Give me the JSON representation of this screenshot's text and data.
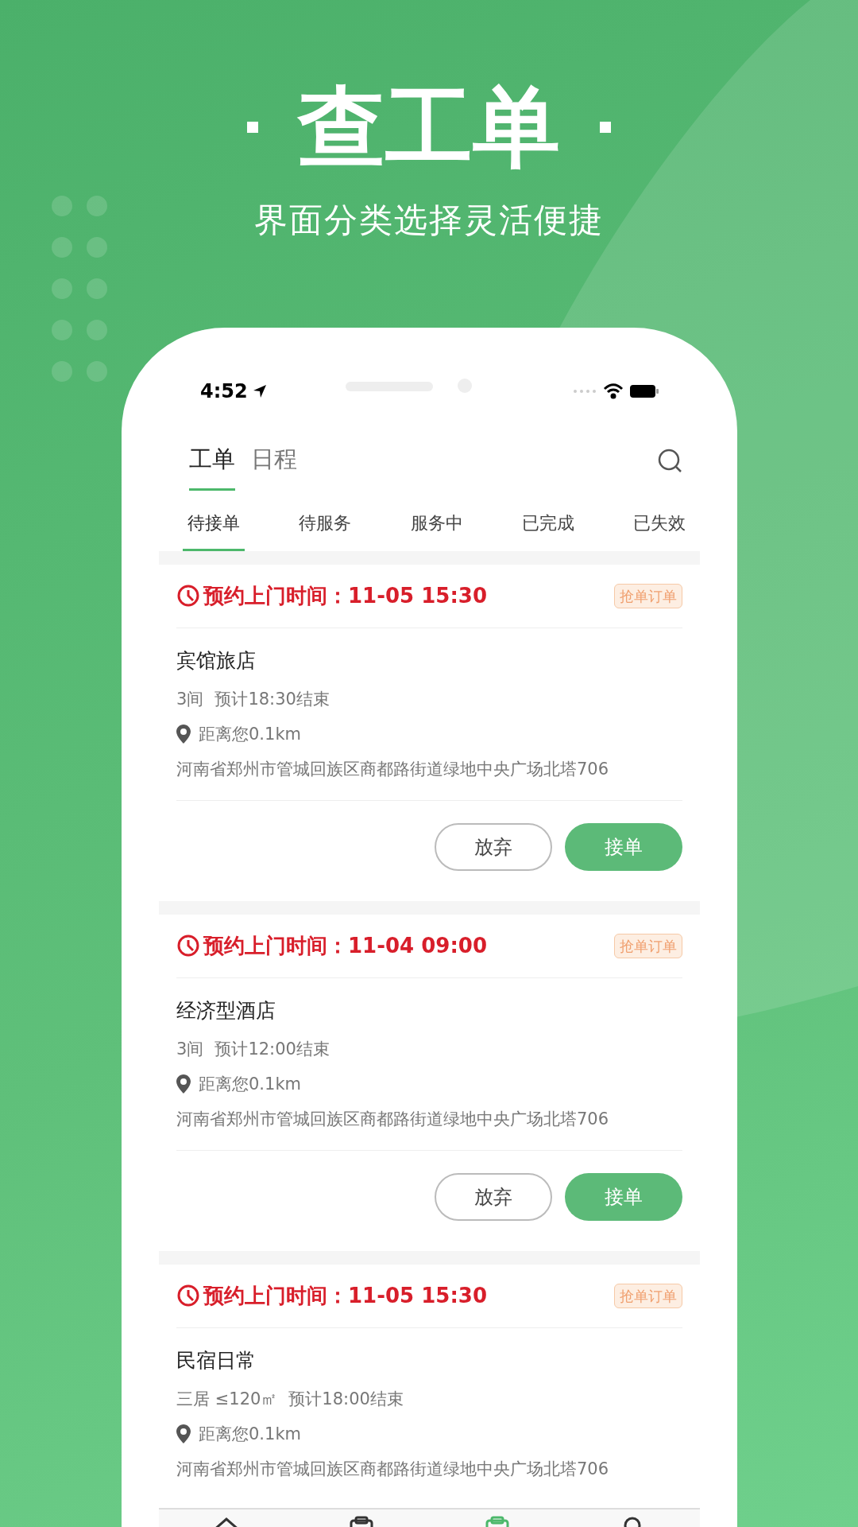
{
  "headline": {
    "title": "查工单",
    "subtitle": "界面分类选择灵活便捷"
  },
  "status_bar": {
    "time": "4:52"
  },
  "top_tabs": [
    {
      "label": "工单",
      "selected": true
    },
    {
      "label": "日程",
      "selected": false
    }
  ],
  "status_tabs": [
    {
      "label": "待接单",
      "selected": true
    },
    {
      "label": "待服务",
      "selected": false
    },
    {
      "label": "服务中",
      "selected": false
    },
    {
      "label": "已完成",
      "selected": false
    },
    {
      "label": "已失效",
      "selected": false
    }
  ],
  "orders": [
    {
      "time": "预约上门时间：11-05 15:30",
      "badge": "抢单订单",
      "name": "宾馆旅店",
      "details": [
        "3间",
        "预计18:30结束"
      ],
      "distance": "距离您0.1km",
      "address": "河南省郑州市管城回族区商都路街道绿地中央广场北塔706",
      "buttons": [
        {
          "label": "放弃",
          "kind": "outline"
        },
        {
          "label": "接单",
          "kind": "primary"
        }
      ]
    },
    {
      "time": "预约上门时间：11-04 09:00",
      "badge": "抢单订单",
      "name": "经济型酒店",
      "details": [
        "3间",
        "预计12:00结束"
      ],
      "distance": "距离您0.1km",
      "address": "河南省郑州市管城回族区商都路街道绿地中央广场北塔706",
      "buttons": [
        {
          "label": "放弃",
          "kind": "outline"
        },
        {
          "label": "接单",
          "kind": "primary"
        }
      ]
    },
    {
      "time": "预约上门时间：11-05 15:30",
      "badge": "抢单订单",
      "name": "民宿日常",
      "details": [
        "三居 ≤120㎡",
        "预计18:00结束"
      ],
      "distance": "距离您0.1km",
      "address": "河南省郑州市管城回族区商都路街道绿地中央广场北塔706"
    }
  ],
  "bottom_nav": [
    {
      "kind": "home",
      "selected": false
    },
    {
      "kind": "clipboard",
      "selected": false
    },
    {
      "kind": "clipboard",
      "selected": true
    },
    {
      "kind": "person",
      "selected": false
    }
  ]
}
